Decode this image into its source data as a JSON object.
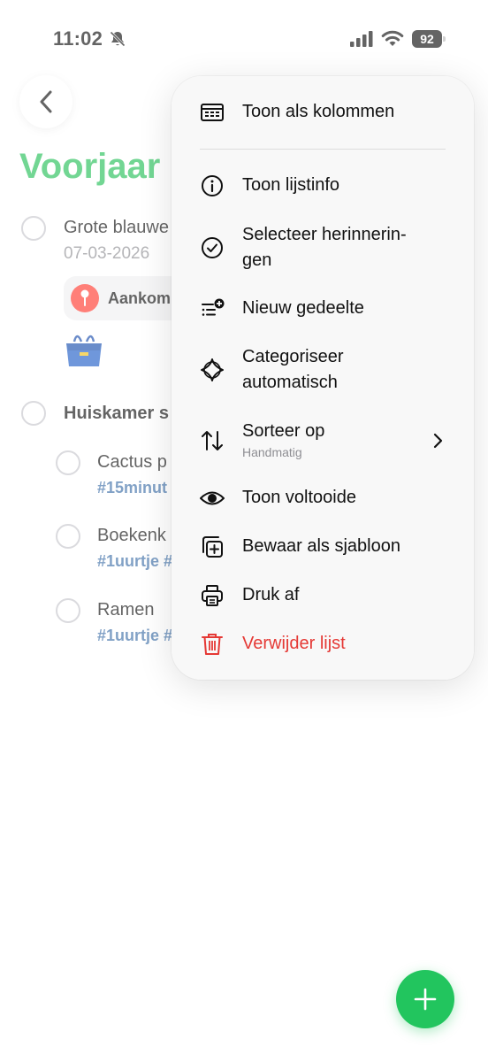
{
  "status_bar": {
    "time": "11:02",
    "battery": "92"
  },
  "list": {
    "title": "Voorjaar",
    "items": [
      {
        "text": "Grote blauwe",
        "date": "07-03-2026",
        "chip": "Aankom"
      },
      {
        "section": "Huiskamer s"
      },
      {
        "text": "Cactus p",
        "tags": "#15minut"
      },
      {
        "text": "Boekenk",
        "tags": "#1uurtje #"
      },
      {
        "text": "Ramen",
        "tags": "#1uurtje #"
      }
    ]
  },
  "menu": {
    "items": [
      {
        "label": "Toon als kolommen",
        "icon": "columns-icon"
      },
      {
        "label": "Toon lijstinfo",
        "icon": "info-icon"
      },
      {
        "label": "Selecteer herinnerin-",
        "label2": "gen",
        "icon": "checkmark-circle-icon"
      },
      {
        "label": "Nieuw gedeelte",
        "icon": "new-section-icon"
      },
      {
        "label": "Categoriseer",
        "label2": "automatisch",
        "icon": "sparkle-icon"
      },
      {
        "label": "Sorteer op",
        "sublabel": "Handmatig",
        "icon": "sort-icon"
      },
      {
        "label": "Toon voltooide",
        "icon": "eye-icon"
      },
      {
        "label": "Bewaar als sjabloon",
        "icon": "template-icon"
      },
      {
        "label": "Druk af",
        "icon": "printer-icon"
      },
      {
        "label": "Verwijder lijst",
        "icon": "trash-icon"
      }
    ]
  },
  "colors": {
    "accent": "#27c05a",
    "danger": "#e53935",
    "tag": "#3e6fa8",
    "fab": "#22c55e"
  }
}
